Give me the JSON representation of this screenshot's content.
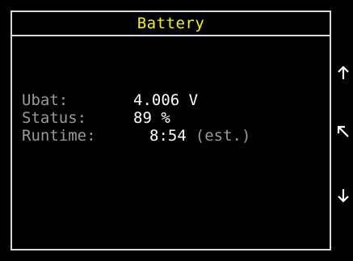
{
  "screen": {
    "title": "Battery"
  },
  "fields": [
    {
      "label": "Ubat:",
      "value": "4.006 V",
      "note": ""
    },
    {
      "label": "Status:",
      "value": "89 %",
      "note": ""
    },
    {
      "label": "Runtime:",
      "value": "8:54",
      "note": "(est.)"
    }
  ],
  "softkeys": {
    "up": "arrow-up-icon",
    "back": "arrow-up-left-icon",
    "down": "arrow-down-icon"
  },
  "colors": {
    "background": "#000000",
    "title": "#f5f500",
    "label": "#9a9a9a",
    "value": "#ffffff",
    "frame": "#d8d8d8"
  }
}
